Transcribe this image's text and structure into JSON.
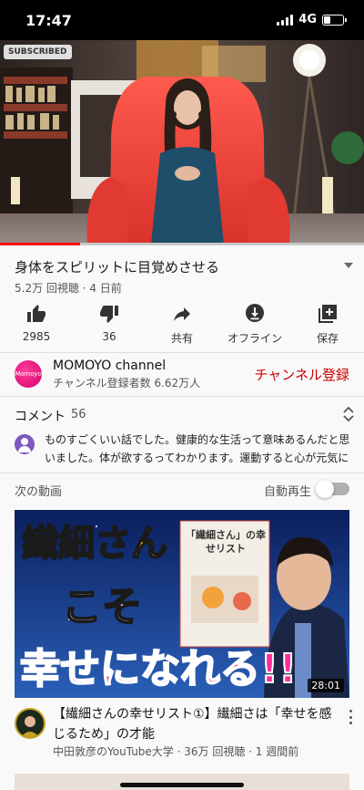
{
  "status_bar": {
    "time": "17:47",
    "network": "4G",
    "battery_level": 0.35
  },
  "player": {
    "badge": "SUBSCRIBED",
    "progress": 0.22
  },
  "video": {
    "title": "身体をスピリットに目覚めさせる",
    "meta": "5.2万 回視聴 · 4 日前"
  },
  "actions": [
    {
      "icon": "thumbs-up-icon",
      "label": "2985"
    },
    {
      "icon": "thumbs-down-icon",
      "label": "36"
    },
    {
      "icon": "share-icon",
      "label": "共有"
    },
    {
      "icon": "download-icon",
      "label": "オフライン"
    },
    {
      "icon": "add-to-playlist-icon",
      "label": "保存"
    }
  ],
  "channel": {
    "avatar_text": "Momoyo",
    "name": "MOMOYO channel",
    "subscribers": "チャンネル登録者数 6.62万人",
    "subscribe_label": "チャンネル登録"
  },
  "comments": {
    "label": "コメント",
    "count": "56",
    "top_comment": "ものすごくいい話でした。健康的な生活って意味あるんだと思いました。体が欲するってわかります。運動すると心が元気にな…"
  },
  "up_next": {
    "label": "次の動画",
    "autoplay_label": "自動再生",
    "autoplay_on": false
  },
  "recommendation": {
    "thumb_text_1": "繊細さん",
    "thumb_text_2": "こそ",
    "thumb_text_3": "幸せになれる!!",
    "book_title": "「繊細さん」の幸せリスト",
    "duration": "28:01",
    "title": "【繊細さんの幸せリスト①】繊細さは「幸せを感じるため」の才能",
    "meta": "中田敦彦のYouTube大学 · 36万 回視聴 · 1 週間前"
  },
  "colors": {
    "accent": "#cc0000",
    "progress": "#ff0000",
    "thumb_yellow": "#ffe600",
    "thumb_pink": "#ff2d9a"
  }
}
